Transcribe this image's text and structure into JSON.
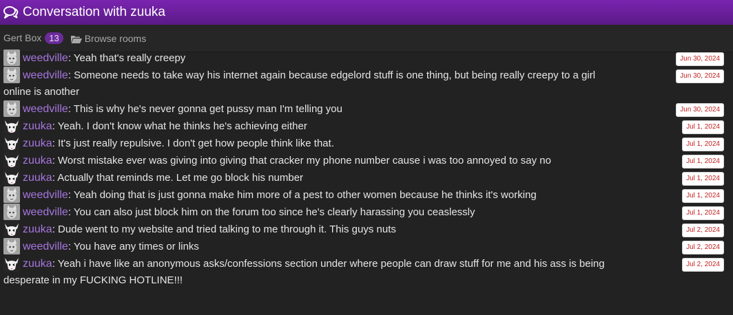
{
  "header": {
    "title": "Conversation with zuuka",
    "icon": "comments-icon"
  },
  "subbar": {
    "box_label": "Gert Box",
    "box_count": "13",
    "rooms_label": "Browse rooms",
    "rooms_icon": "folder-open-icon"
  },
  "colors": {
    "header": "#6a1f9e",
    "username": "#a776e0",
    "date_text": "#c21f1f",
    "badge": "#6a2b9a"
  },
  "messages": [
    {
      "user": "weedville",
      "sep": ": ",
      "text": "Yeah that's really creepy",
      "date": "Jun 30, 2024"
    },
    {
      "user": "weedville",
      "sep": ": ",
      "text": "Someone needs to take way his internet again because edgelord stuff is one thing, but being really creepy to a girl online is another",
      "date": "Jun 30, 2024"
    },
    {
      "user": "weedville",
      "sep": ": ",
      "text": "This is why he's never gonna get pussy man I'm telling you",
      "date": "Jun 30, 2024"
    },
    {
      "user": "zuuka",
      "sep": ": ",
      "text": "Yeah. I don't know what he thinks he's achieving either",
      "date": "Jul 1, 2024"
    },
    {
      "user": "zuuka",
      "sep": ": ",
      "text": "It's just really repulsive. I don't get how people think like that.",
      "date": "Jul 1, 2024"
    },
    {
      "user": "zuuka",
      "sep": ": ",
      "text": "Worst mistake ever was giving into giving that cracker my phone number cause i was too annoyed to say no",
      "date": "Jul 1, 2024"
    },
    {
      "user": "zuuka",
      "sep": ": ",
      "text": "Actually that reminds me. Let me go block his number",
      "date": "Jul 1, 2024"
    },
    {
      "user": "weedville",
      "sep": ": ",
      "text": "Yeah doing that is just gonna make him more of a pest to other women because he thinks it's working",
      "date": "Jul 1, 2024"
    },
    {
      "user": "weedville",
      "sep": ": ",
      "text": "You can also just block him on the forum too since he's clearly harassing you ceaslessly",
      "date": "Jul 1, 2024"
    },
    {
      "user": "zuuka",
      "sep": ": ",
      "text": "Dude went to my website and tried talking to me through it. This guys nuts",
      "date": "Jul 2, 2024"
    },
    {
      "user": "weedville",
      "sep": ": ",
      "text": "You have any times or links",
      "date": "Jul 2, 2024"
    },
    {
      "user": "zuuka",
      "sep": ": ",
      "text": "Yeah i have like an anonymous asks/confessions section under where people can draw stuff for me and his ass is being desperate in my FUCKING HOTLINE!!!",
      "date": "Jul 2, 2024"
    }
  ]
}
